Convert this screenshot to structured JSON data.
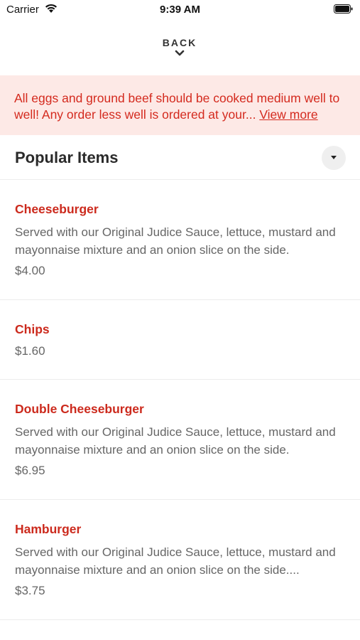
{
  "status_bar": {
    "carrier": "Carrier",
    "time": "9:39 AM"
  },
  "nav": {
    "back_label": "BACK"
  },
  "notice": {
    "text": "All eggs and ground beef should be cooked medium well to well! Any order less well is ordered at your...",
    "link_label": "View more",
    "colors": {
      "background": "#fde9e6",
      "text": "#d42a1e"
    }
  },
  "section": {
    "title": "Popular Items"
  },
  "items": [
    {
      "name": "Cheeseburger",
      "description": "Served with our Original Judice Sauce, lettuce, mustard and mayonnaise mixture and an onion slice on the side.",
      "price": "$4.00"
    },
    {
      "name": "Chips",
      "description": "",
      "price": "$1.60"
    },
    {
      "name": "Double Cheeseburger",
      "description": "Served with our Original Judice Sauce, lettuce, mustard and mayonnaise mixture and an onion slice on the side.",
      "price": "$6.95"
    },
    {
      "name": "Hamburger",
      "description": "Served with our Original Judice Sauce, lettuce, mustard and mayonnaise mixture and an onion slice on the side....",
      "price": "$3.75"
    }
  ],
  "theme": {
    "accent": "#cc2a1d"
  }
}
